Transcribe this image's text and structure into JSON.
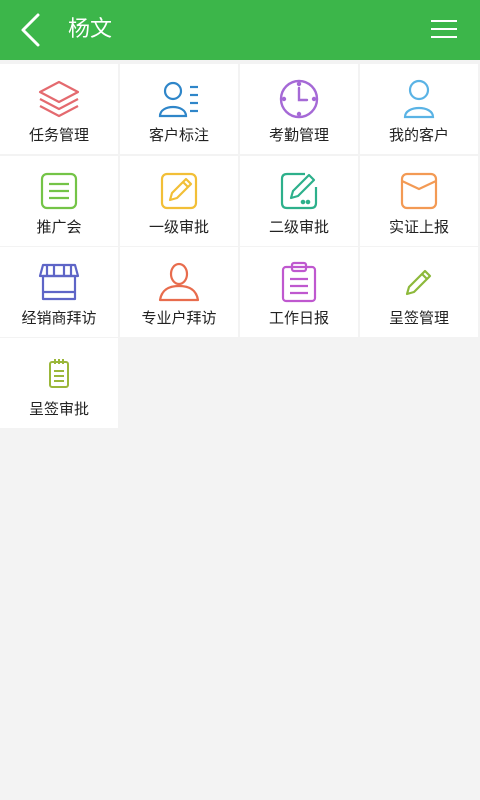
{
  "header": {
    "title": "杨文",
    "bg_color": "#3cb64a",
    "back_icon": "chevron-left-icon",
    "menu_icon": "hamburger-menu-icon"
  },
  "grid": {
    "items": [
      {
        "label": "任务管理",
        "icon": "layers-icon",
        "color": "#e46a6f"
      },
      {
        "label": "客户标注",
        "icon": "user-list-icon",
        "color": "#2f86c9"
      },
      {
        "label": "考勤管理",
        "icon": "clock-icon",
        "color": "#a569d6"
      },
      {
        "label": "我的客户",
        "icon": "user-icon",
        "color": "#5ab3e5"
      },
      {
        "label": "推广会",
        "icon": "list-icon",
        "color": "#74c447"
      },
      {
        "label": "一级审批",
        "icon": "edit-icon",
        "color": "#f2bf37"
      },
      {
        "label": "二级审批",
        "icon": "edit-square-icon",
        "color": "#2db08b"
      },
      {
        "label": "实证上报",
        "icon": "envelope-icon",
        "color": "#f39a54"
      },
      {
        "label": "经销商拜访",
        "icon": "shop-icon",
        "color": "#5e65c7"
      },
      {
        "label": "专业户拜访",
        "icon": "person-icon",
        "color": "#e86c4d"
      },
      {
        "label": "工作日报",
        "icon": "clipboard-icon",
        "color": "#bf58cf"
      },
      {
        "label": "呈签管理",
        "icon": "pencil-icon",
        "color": "#8db93b"
      },
      {
        "label": "呈签审批",
        "icon": "notepad-icon",
        "color": "#9bb73a"
      }
    ]
  }
}
